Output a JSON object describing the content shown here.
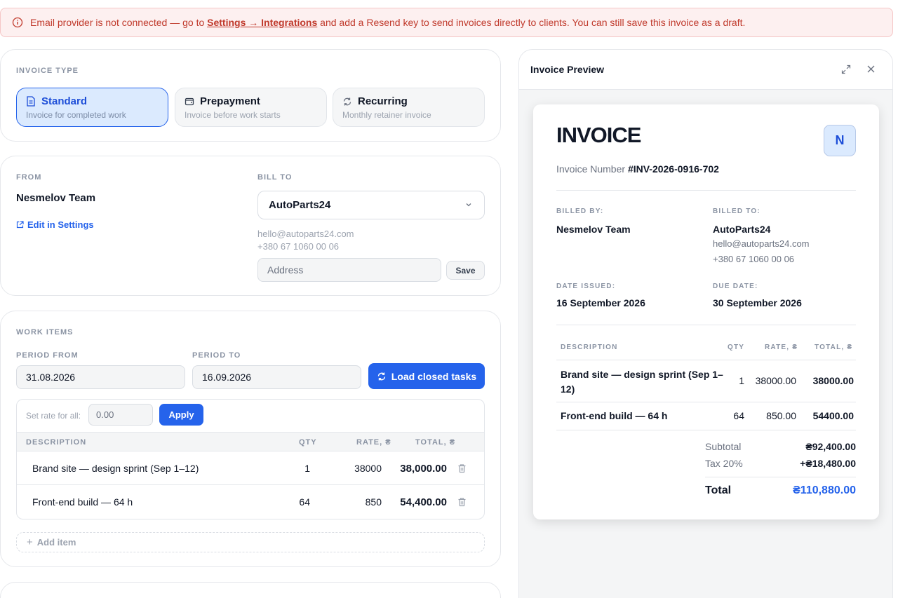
{
  "alert": {
    "prefix": "Email provider is not connected — go to ",
    "link": "Settings → Integrations",
    "suffix": " and add a Resend key to send invoices directly to clients. You can still save this invoice as a draft."
  },
  "invoice_type": {
    "label": "INVOICE TYPE",
    "options": [
      {
        "title": "Standard",
        "subtitle": "Invoice for completed work",
        "icon": "document-icon",
        "selected": true
      },
      {
        "title": "Prepayment",
        "subtitle": "Invoice before work starts",
        "icon": "wallet-icon",
        "selected": false
      },
      {
        "title": "Recurring",
        "subtitle": "Monthly retainer invoice",
        "icon": "refresh-icon",
        "selected": false
      }
    ]
  },
  "from": {
    "label": "FROM",
    "name": "Nesmelov Team",
    "edit_label": "Edit in Settings"
  },
  "bill_to": {
    "label": "BILL TO",
    "selected_client": "AutoParts24",
    "email": "hello@autoparts24.com",
    "phone": "+380 67 1060 00 06",
    "address_placeholder": "Address",
    "save_label": "Save"
  },
  "work_items": {
    "label": "WORK ITEMS",
    "period_from_label": "PERIOD FROM",
    "period_from": "31.08.2026",
    "period_to_label": "PERIOD TO",
    "period_to": "16.09.2026",
    "load_label": "Load closed tasks",
    "rate_label": "Set rate for all:",
    "rate_placeholder": "0.00",
    "apply_label": "Apply",
    "columns": [
      "DESCRIPTION",
      "QTY",
      "RATE, ₴",
      "TOTAL, ₴"
    ],
    "rows": [
      {
        "description": "Brand site — design sprint (Sep 1–12)",
        "qty": "1",
        "rate": "38000",
        "total": "38,000.00"
      },
      {
        "description": "Front-end build — 64 h",
        "qty": "64",
        "rate": "850",
        "total": "54,400.00"
      }
    ],
    "add_label": "Add item"
  },
  "preview": {
    "title": "Invoice Preview",
    "heading": "INVOICE",
    "logo_letter": "N",
    "number_label": "Invoice Number",
    "number": "#INV-2026-0916-702",
    "billed_by_label": "BILLED BY:",
    "billed_by": "Nesmelov Team",
    "billed_to_label": "BILLED TO:",
    "billed_to": "AutoParts24",
    "billed_to_email": "hello@autoparts24.com",
    "billed_to_phone": "+380 67 1060 00 06",
    "issued_label": "DATE ISSUED:",
    "issued": "16 September 2026",
    "due_label": "DUE DATE:",
    "due": "30 September 2026",
    "columns": [
      "DESCRIPTION",
      "QTY",
      "RATE, ₴",
      "TOTAL, ₴"
    ],
    "rows": [
      {
        "description_line1": "Brand site — design sprint (Sep 1–",
        "description_line2": "12)",
        "qty": "1",
        "rate": "38000.00",
        "total": "38000.00"
      },
      {
        "description_line1": "Front-end build — 64 h",
        "description_line2": "",
        "qty": "64",
        "rate": "850.00",
        "total": "54400.00"
      }
    ],
    "subtotal_label": "Subtotal",
    "subtotal": "₴92,400.00",
    "tax_label": "Tax 20%",
    "tax": "+₴18,480.00",
    "total_label": "Total",
    "total": "₴110,880.00"
  },
  "colors": {
    "accent": "#2563eb",
    "alert_text": "#c0392b",
    "alert_bg": "#fdf0f0"
  }
}
